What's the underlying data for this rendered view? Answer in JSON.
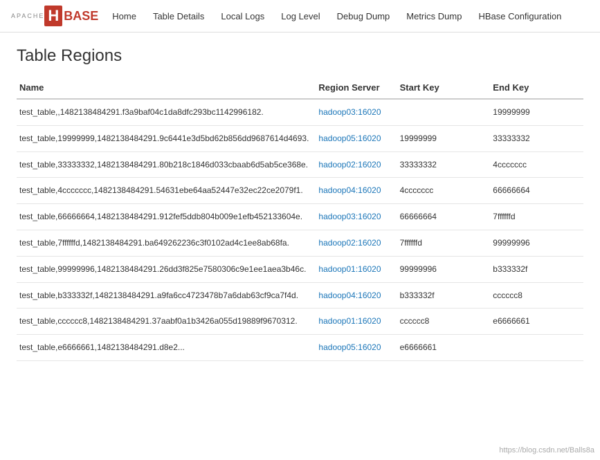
{
  "nav": {
    "apache_label": "APACHE",
    "logo_h": "H",
    "logo_base": "BASE",
    "items": [
      {
        "label": "Home",
        "href": "#"
      },
      {
        "label": "Table Details",
        "href": "#"
      },
      {
        "label": "Local Logs",
        "href": "#"
      },
      {
        "label": "Log Level",
        "href": "#"
      },
      {
        "label": "Debug Dump",
        "href": "#"
      },
      {
        "label": "Metrics Dump",
        "href": "#"
      },
      {
        "label": "HBase Configuration",
        "href": "#"
      }
    ]
  },
  "page": {
    "title": "Table Regions"
  },
  "table": {
    "headers": [
      "Name",
      "Region Server",
      "Start Key",
      "End Key"
    ],
    "rows": [
      {
        "name": "test_table,,1482138484291.f3a9baf04c1da8dfc293bc1142996182.",
        "server": "hadoop03:16020",
        "start_key": "",
        "end_key": "19999999"
      },
      {
        "name": "test_table,19999999,1482138484291.9c6441e3d5bd62b856dd9687614d4693.",
        "server": "hadoop05:16020",
        "start_key": "19999999",
        "end_key": "33333332"
      },
      {
        "name": "test_table,33333332,1482138484291.80b218c1846d033cbaab6d5ab5ce368e.",
        "server": "hadoop02:16020",
        "start_key": "33333332",
        "end_key": "4ccccccc"
      },
      {
        "name": "test_table,4ccccccc,1482138484291.54631ebe64aa52447e32ec22ce2079f1.",
        "server": "hadoop04:16020",
        "start_key": "4ccccccc",
        "end_key": "66666664"
      },
      {
        "name": "test_table,66666664,1482138484291.912fef5ddb804b009e1efb452133604e.",
        "server": "hadoop03:16020",
        "start_key": "66666664",
        "end_key": "7ffffffd"
      },
      {
        "name": "test_table,7ffffffd,1482138484291.ba649262236c3f0102ad4c1ee8ab68fa.",
        "server": "hadoop02:16020",
        "start_key": "7ffffffd",
        "end_key": "99999996"
      },
      {
        "name": "test_table,99999996,1482138484291.26dd3f825e7580306c9e1ee1aea3b46c.",
        "server": "hadoop01:16020",
        "start_key": "99999996",
        "end_key": "b333332f"
      },
      {
        "name": "test_table,b333332f,1482138484291.a9fa6cc4723478b7a6dab63cf9ca7f4d.",
        "server": "hadoop04:16020",
        "start_key": "b333332f",
        "end_key": "cccccc8"
      },
      {
        "name": "test_table,cccccc8,1482138484291.37aabf0a1b3426a055d19889f9670312.",
        "server": "hadoop01:16020",
        "start_key": "cccccc8",
        "end_key": "e6666661"
      },
      {
        "name": "test_table,e6666661,1482138484291.d8e2...",
        "server": "hadoop05:16020",
        "start_key": "e6666661",
        "end_key": ""
      }
    ]
  },
  "watermark": "https://blog.csdn.net/Balls8a"
}
